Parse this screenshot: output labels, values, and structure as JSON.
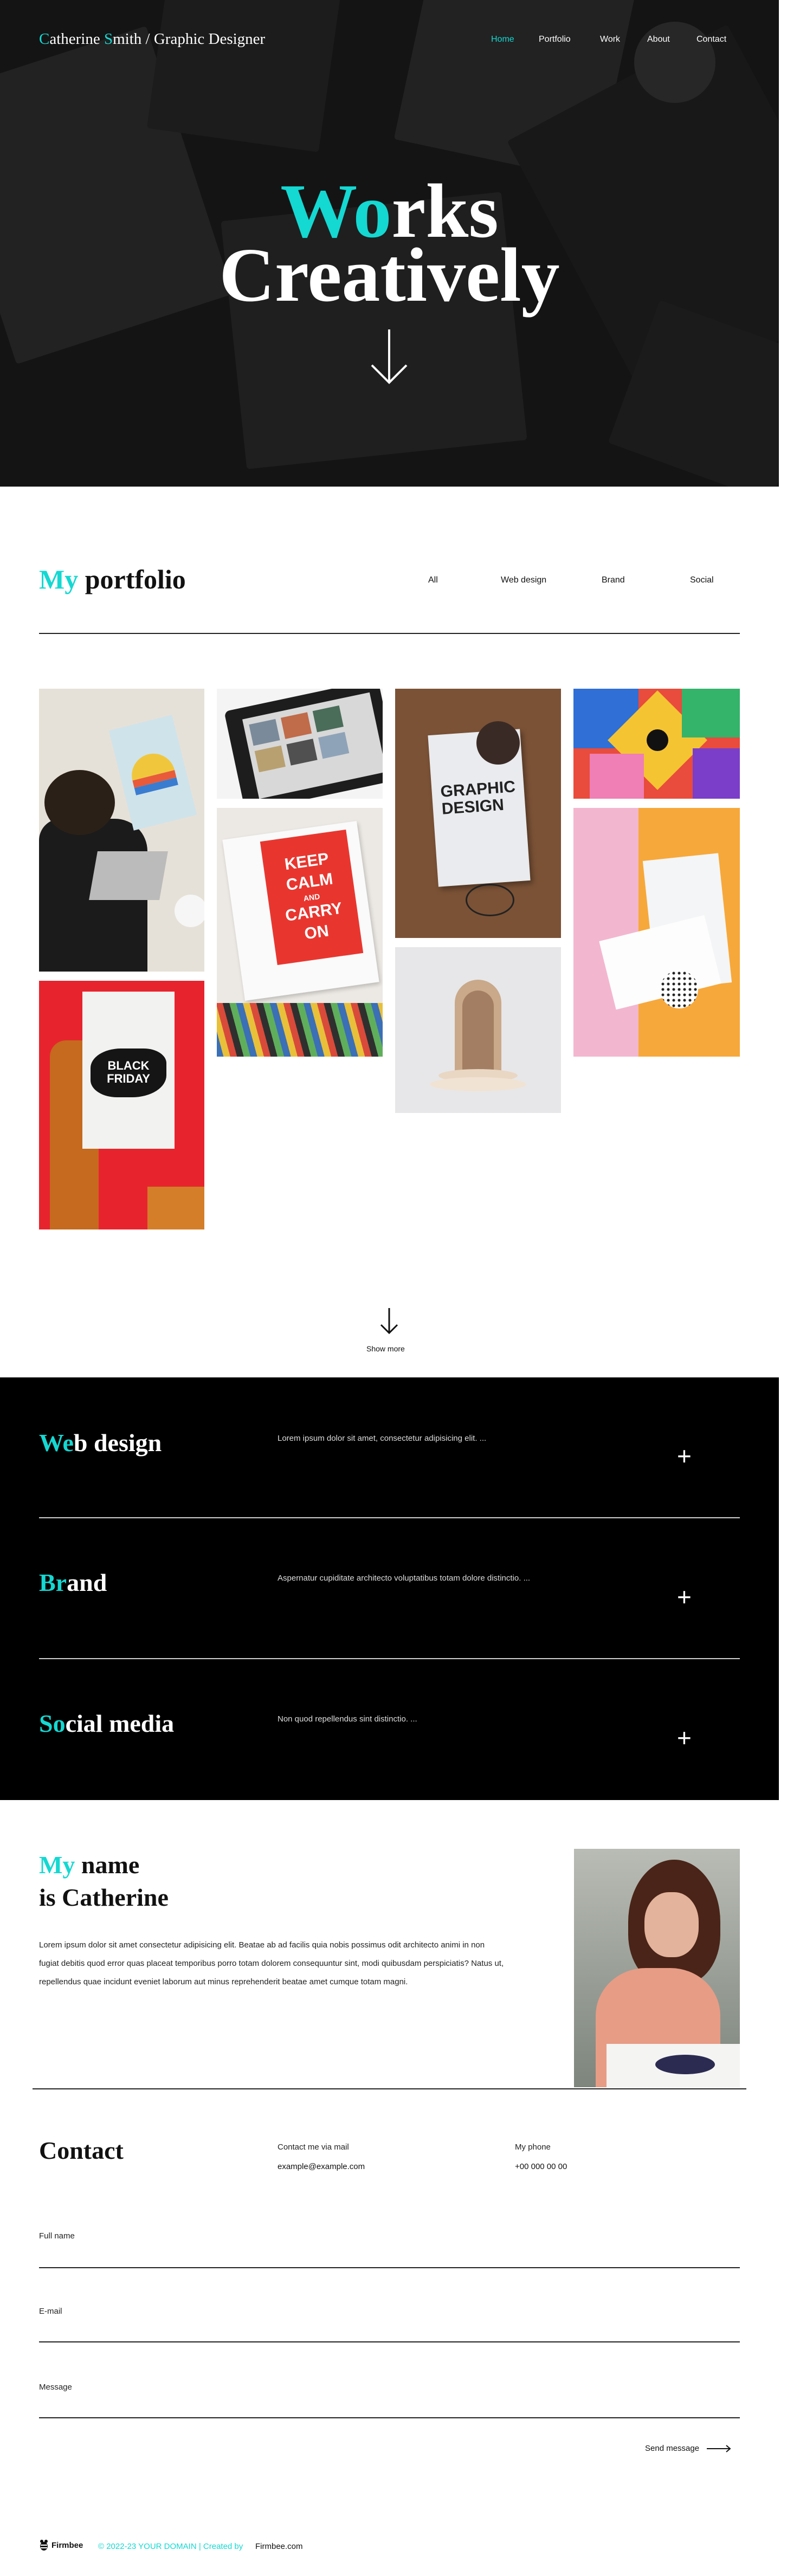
{
  "header": {
    "brand_first": "C",
    "brand_mid1": "atherine ",
    "brand_s": "S",
    "brand_rest": "mith / Graphic Designer",
    "nav": [
      {
        "label": "Home"
      },
      {
        "label": "Portfolio"
      },
      {
        "label": "Work"
      },
      {
        "label": "About"
      },
      {
        "label": "Contact"
      }
    ]
  },
  "hero": {
    "title_accent": "Wo",
    "title_rest": "rks",
    "title_line2": "Creatively",
    "scroll_icon": "arrow-down-icon"
  },
  "portfolio": {
    "title_accent": "My",
    "title_rest": " portfolio",
    "filters": [
      "All",
      "Web design",
      "Brand",
      "Social"
    ],
    "images": [
      {
        "name": "person-laptop-image"
      },
      {
        "name": "monitor-screens-image"
      },
      {
        "name": "graphic-design-book-image"
      },
      {
        "name": "colorful-mural-image"
      },
      {
        "name": "keep-calm-poster-image",
        "poster_lines": [
          "KEEP",
          "CALM",
          "AND",
          "CARRY",
          "ON"
        ]
      },
      {
        "name": "envelope-cards-image"
      },
      {
        "name": "arch-sculpture-image"
      },
      {
        "name": "black-friday-poster-image",
        "poster_lines": [
          "BLACK",
          "FRIDAY"
        ]
      }
    ],
    "book_lines": [
      "GRAPHIC",
      "DESIGN"
    ],
    "show_more": "Show more"
  },
  "services": [
    {
      "title_accent": "We",
      "title_rest": "b design",
      "desc": "Lorem ipsum dolor sit amet, consectetur adipisicing elit. ..."
    },
    {
      "title_accent": "Br",
      "title_rest": "and",
      "desc": "Aspernatur cupiditate architecto voluptatibus totam dolore distinctio. ..."
    },
    {
      "title_accent": "So",
      "title_rest": "cial media",
      "desc": "Non quod repellendus sint distinctio. ..."
    }
  ],
  "about": {
    "line1_accent": "My",
    "line1_rest": " name",
    "line2": "is Catherine",
    "text": "Lorem ipsum dolor sit amet consectetur adipisicing elit. Beatae ab ad facilis quia nobis possimus odit architecto animi in non fugiat debitis quod error quas placeat temporibus porro totam dolorem consequuntur sint, modi quibusdam perspiciatis? Natus ut, repellendus quae incidunt eveniet laborum aut minus reprehenderit beatae amet cumque totam magni."
  },
  "contact": {
    "title": "Contact",
    "mail_label": "Contact me via mail",
    "mail_value": "example@example.com",
    "phone_label": "My phone",
    "phone_value": "+00 000 00 00",
    "fields": [
      "Full name",
      "E-mail",
      "Message"
    ],
    "send": "Send message"
  },
  "footer": {
    "logo": "Firmbee",
    "copyright": "© 2022-23 YOUR DOMAIN | Created by",
    "credit": "Firmbee.com"
  },
  "colors": {
    "accent": "#14d8d2",
    "dark": "#000000"
  }
}
